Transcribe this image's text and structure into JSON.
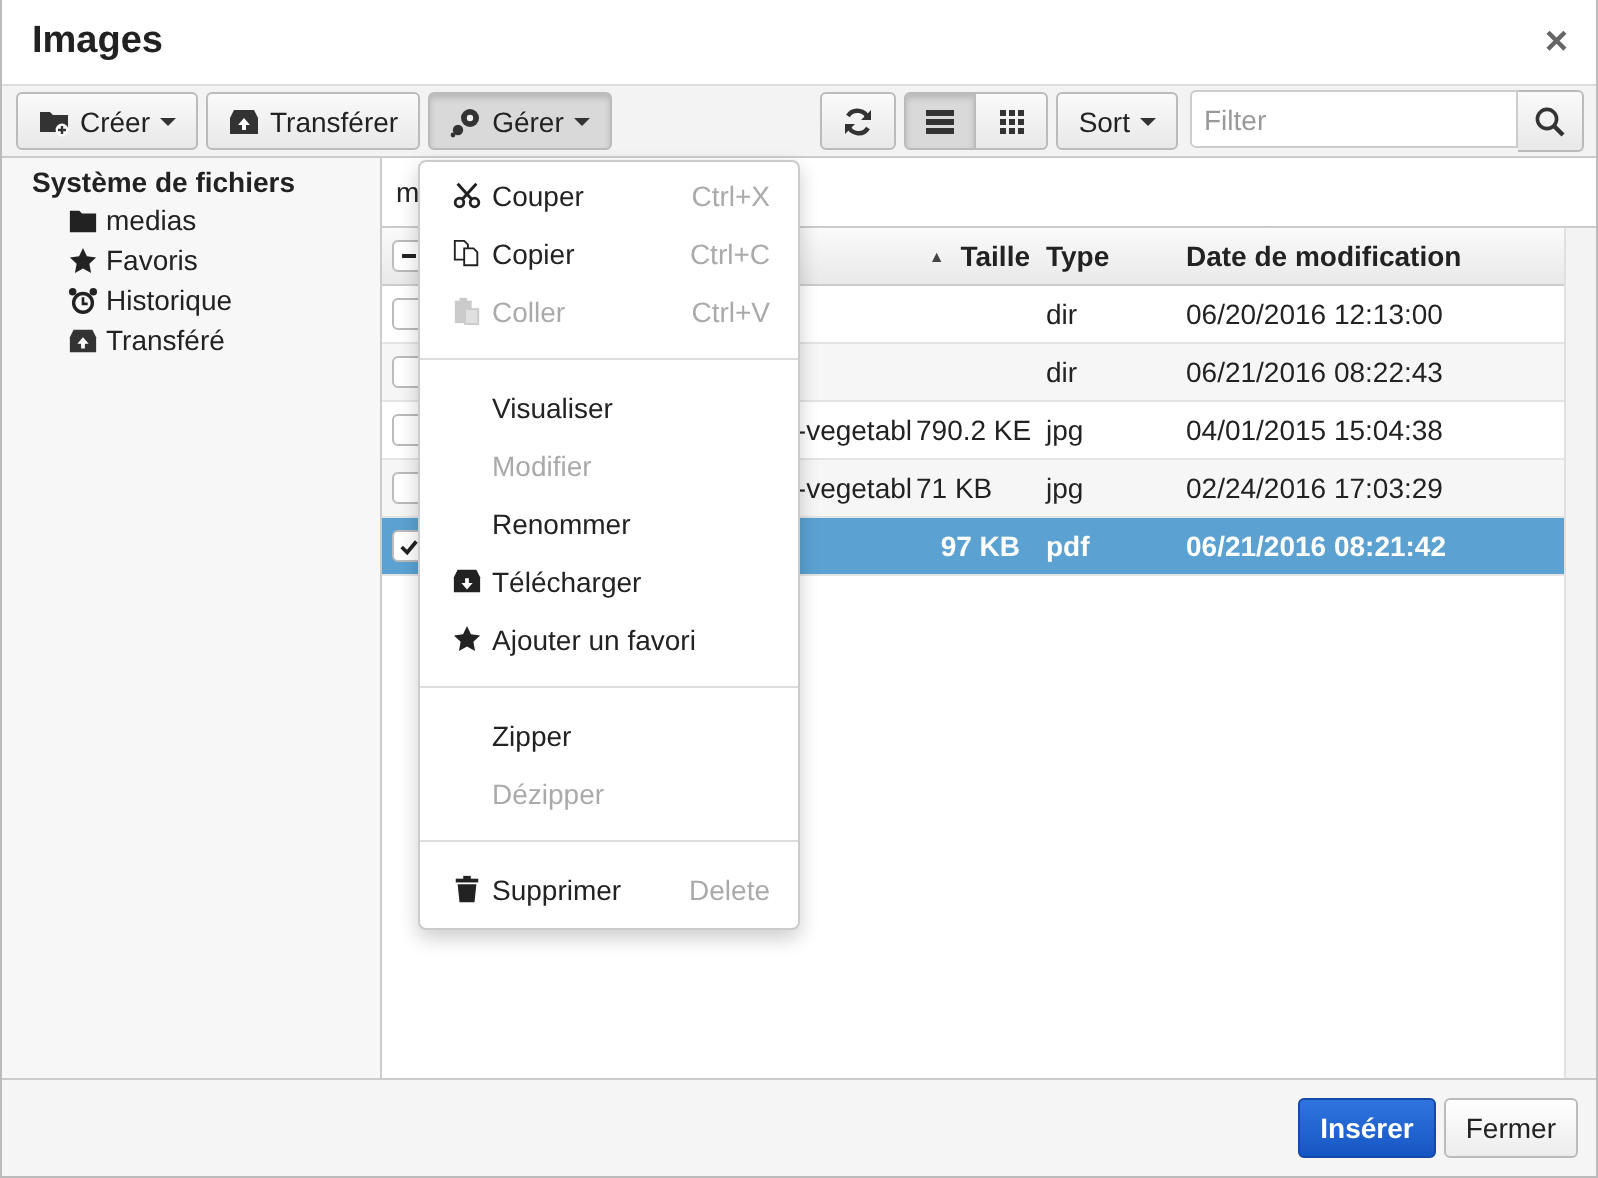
{
  "window": {
    "title": "Images",
    "close": "×"
  },
  "toolbar": {
    "buttons": [
      {
        "kind": "create",
        "label": "Créer",
        "dropdown": true,
        "pressed": false
      },
      {
        "kind": "upload",
        "label": "Transférer",
        "dropdown": false,
        "pressed": false
      },
      {
        "kind": "manage",
        "label": "Gérer",
        "dropdown": true,
        "pressed": true
      }
    ],
    "views": [
      {
        "kind": "list",
        "selected": true
      },
      {
        "kind": "grid",
        "selected": false
      }
    ],
    "sort": {
      "label": "Sort"
    },
    "filter": {
      "placeholder": "Filter"
    }
  },
  "sidebar": {
    "title": "Système de fichiers",
    "items": [
      {
        "kind": "folder",
        "label": "medias"
      },
      {
        "kind": "favorites",
        "label": "Favoris"
      },
      {
        "kind": "history",
        "label": "Historique"
      },
      {
        "kind": "upload",
        "label": "Transféré"
      }
    ]
  },
  "breadcrumb": "m",
  "table": {
    "select_all": {
      "indeterminate": true
    },
    "columns": [
      {
        "label": "Taille",
        "sort_indicator": "▲"
      },
      {
        "label": "Type"
      },
      {
        "label": "Date de modification"
      }
    ],
    "rows": [
      {
        "checked": false,
        "selected": false,
        "type": "dir",
        "modified": "06/20/2016 12:13:00"
      },
      {
        "checked": false,
        "selected": false,
        "type": "dir",
        "modified": "06/21/2016 08:22:43"
      },
      {
        "checked": false,
        "selected": false,
        "name": "-vegetabl",
        "size": "790.2 KE",
        "type": "jpg",
        "modified": "04/01/2015 15:04:38"
      },
      {
        "checked": false,
        "selected": false,
        "name": "-vegetabl",
        "size": "71 KB",
        "type": "jpg",
        "modified": "02/24/2016 17:03:29"
      },
      {
        "checked": true,
        "selected": true,
        "size": "97 KB",
        "type": "pdf",
        "modified": "06/21/2016 08:21:42"
      }
    ]
  },
  "menu": {
    "items": [
      {
        "kind": "cut",
        "label": "Couper",
        "shortcut": "Ctrl+X",
        "disabled": false
      },
      {
        "kind": "copy",
        "label": "Copier",
        "shortcut": "Ctrl+C",
        "disabled": false
      },
      {
        "kind": "paste",
        "label": "Coller",
        "shortcut": "Ctrl+V",
        "disabled": true
      },
      {
        "kind": "separator"
      },
      {
        "kind": "plain",
        "label": "Visualiser",
        "disabled": false
      },
      {
        "kind": "plain",
        "label": "Modifier",
        "disabled": true
      },
      {
        "kind": "plain",
        "label": "Renommer",
        "disabled": false
      },
      {
        "kind": "download",
        "label": "Télécharger",
        "disabled": false
      },
      {
        "kind": "favorite",
        "label": "Ajouter un favori",
        "disabled": false
      },
      {
        "kind": "separator"
      },
      {
        "kind": "plain",
        "label": "Zipper",
        "disabled": false
      },
      {
        "kind": "plain",
        "label": "Dézipper",
        "disabled": true
      },
      {
        "kind": "separator"
      },
      {
        "kind": "delete",
        "label": "Supprimer",
        "shortcut": "Delete",
        "disabled": false
      }
    ]
  },
  "footer": {
    "buttons": [
      {
        "label": "Insérer",
        "primary": true
      },
      {
        "label": "Fermer",
        "primary": false
      }
    ]
  }
}
